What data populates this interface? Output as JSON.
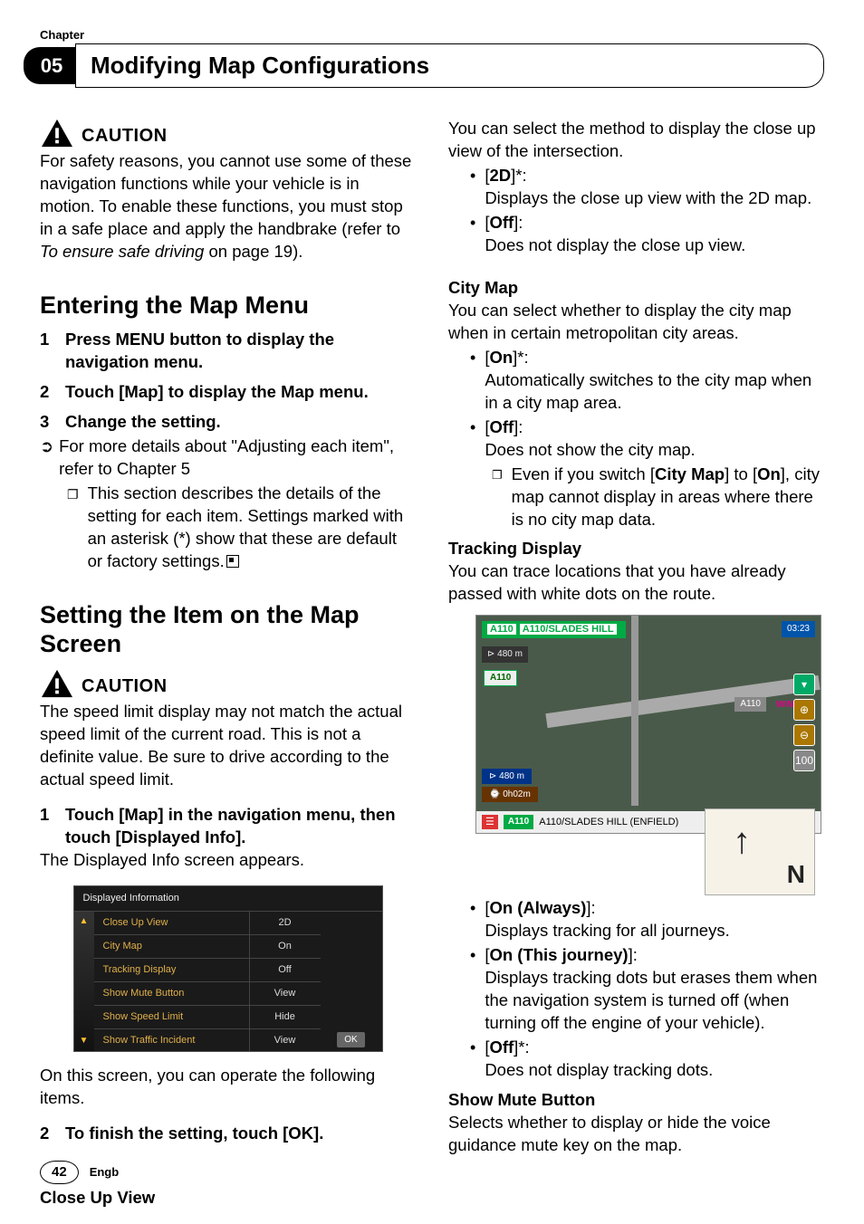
{
  "chapter": {
    "label": "Chapter",
    "number": "05",
    "title": "Modifying Map Configurations"
  },
  "col1": {
    "caution1": {
      "heading": "CAUTION",
      "body_a": "For safety reasons, you cannot use some of these navigation functions while your vehicle is in motion. To enable these functions, you must stop in a safe place and apply the handbrake (refer to ",
      "body_it": "To ensure safe driving",
      "body_b": " on page 19)."
    },
    "h1a": "Entering the Map Menu",
    "step1_n": "1",
    "step1_t": "Press MENU button to display the navigation menu.",
    "step2_n": "2",
    "step2_t": "Touch [Map] to display the Map menu.",
    "step3_n": "3",
    "step3_t": "Change the setting.",
    "arrow_a": "For more details about \"Adjusting each item\", refer to Chapter 5",
    "note_a": "This section describes the details of the setting for each item. Settings marked with an asterisk (*) show that these are default or factory settings.",
    "h1b": "Setting the Item on the Map Screen",
    "caution2": {
      "heading": "CAUTION",
      "body": "The speed limit display may not match the actual speed limit of the current road. This is not a definite value. Be sure to drive according to the actual speed limit."
    },
    "step4_n": "1",
    "step4_t": "Touch [Map] in the navigation menu, then touch [Displayed Info].",
    "step4_after": "The Displayed Info screen appears.",
    "ui": {
      "title": "Displayed Information",
      "rows": [
        {
          "l": "Close Up View",
          "r": "2D"
        },
        {
          "l": "City Map",
          "r": "On"
        },
        {
          "l": "Tracking Display",
          "r": "Off"
        },
        {
          "l": "Show Mute Button",
          "r": "View"
        },
        {
          "l": "Show Speed Limit",
          "r": "Hide"
        },
        {
          "l": "Show Traffic Incident",
          "r": "View"
        }
      ],
      "ok": "OK"
    },
    "after_ui": "On this screen, you can operate the following items.",
    "step5_n": "2",
    "step5_t": "To finish the setting, touch [OK].",
    "close_up": "Close Up View"
  },
  "col2": {
    "intro": "You can select the method to display the close up view of the intersection.",
    "b1_label": "2D",
    "b1_star": "]*:",
    "b1_desc": "Displays the close up view with the 2D map.",
    "b2_label": "Off",
    "b2_close": "]:",
    "b2_desc": "Does not display the close up view.",
    "citymap_h": "City Map",
    "citymap_intro": "You can select whether to display the city map when in certain metropolitan city areas.",
    "cm1_label": "On",
    "cm1_star": "]*:",
    "cm1_desc": "Automatically switches to the city map when in a city map area.",
    "cm2_label": "Off",
    "cm2_close": "]:",
    "cm2_desc": "Does not show the city map.",
    "cm_note_a": "Even if you switch [",
    "cm_note_b": "City Map",
    "cm_note_c": "] to [",
    "cm_note_d": "On",
    "cm_note_e": "], city map cannot display in areas where there is no city map data.",
    "track_h": "Tracking Display",
    "track_intro": "You can trace locations that you have already passed with white dots on the route.",
    "map": {
      "top_tag": "A110",
      "top": "A110/SLADES HILL",
      "time": "03:23",
      "info": "480 m",
      "badge": "A110",
      "road_lbl": "SLADES HILL",
      "side_lbl": "A110",
      "side_lbl2": "WINDML",
      "dist": "480 m",
      "eta": "0h02m",
      "bottom_tag": "A110",
      "bottom": "A110/SLADES HILL (ENFIELD)",
      "scale": "100",
      "inset_dir": "↑",
      "inset_n": "N"
    },
    "t1_label": "On (Always)",
    "t1_close": "]:",
    "t1_desc": "Displays tracking for all journeys.",
    "t2_label": "On (This journey)",
    "t2_close": "]:",
    "t2_desc": "Displays tracking dots but erases them when the navigation system is turned off (when turning off the engine of your vehicle).",
    "t3_label": "Off",
    "t3_star": "]*:",
    "t3_desc": "Does not display tracking dots.",
    "mute_h": "Show Mute Button",
    "mute_intro": "Selects whether to display or hide the voice guidance mute key on the map."
  },
  "footer": {
    "page": "42",
    "lang": "Engb"
  }
}
